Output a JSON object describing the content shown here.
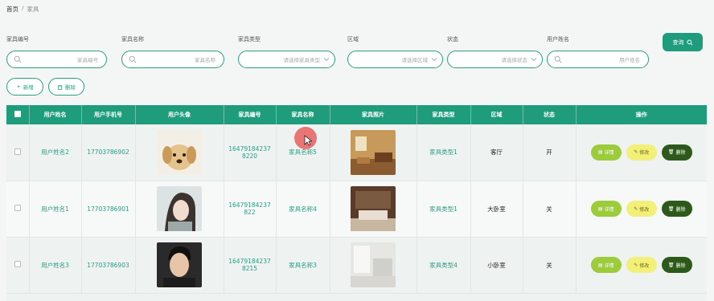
{
  "breadcrumb": {
    "home": "首页",
    "separator": "/",
    "current": "家具"
  },
  "filters": {
    "furniture_no": {
      "label": "家具编号",
      "placeholder": "家具编号"
    },
    "furniture_name": {
      "label": "家具名称",
      "placeholder": "家具名称"
    },
    "furniture_type": {
      "label": "家具类型",
      "placeholder": "请选择家具类型"
    },
    "area": {
      "label": "区域",
      "placeholder": "请选择区域"
    },
    "status": {
      "label": "状态",
      "placeholder": "请选择状态"
    },
    "user_name": {
      "label": "用户姓名",
      "placeholder": "用户姓名"
    }
  },
  "actions": {
    "search": "查询",
    "add": "新增",
    "delete": "删除"
  },
  "table": {
    "headers": [
      "用户姓名",
      "用户手机号",
      "用户头像",
      "家具编号",
      "家具名称",
      "家具照片",
      "家具类型",
      "区域",
      "状态",
      "操作"
    ],
    "rows": [
      {
        "user_name": "用户姓名2",
        "phone": "17703786902",
        "furniture_no_1": "16479184237",
        "furniture_no_2": "8220",
        "furniture_name": "家具名称5",
        "type": "家具类型1",
        "area": "客厅",
        "status": "开"
      },
      {
        "user_name": "用户姓名1",
        "phone": "17703786901",
        "furniture_no_1": "16479184237",
        "furniture_no_2": "822",
        "furniture_name": "家具名称4",
        "type": "家具类型1",
        "area": "大卧室",
        "status": "关"
      },
      {
        "user_name": "用户姓名3",
        "phone": "17703786903",
        "furniture_no_1": "16479184237",
        "furniture_no_2": "8215",
        "furniture_name": "家具名称3",
        "type": "家具类型4",
        "area": "小卧室",
        "status": "关"
      }
    ],
    "row_actions": {
      "detail": "详情",
      "edit": "修改",
      "remove": "删除"
    }
  },
  "colors": {
    "accent": "#1f9c7c",
    "detail": "#9ccc3a",
    "edit": "#f3f07a",
    "remove": "#2d5a1a"
  }
}
